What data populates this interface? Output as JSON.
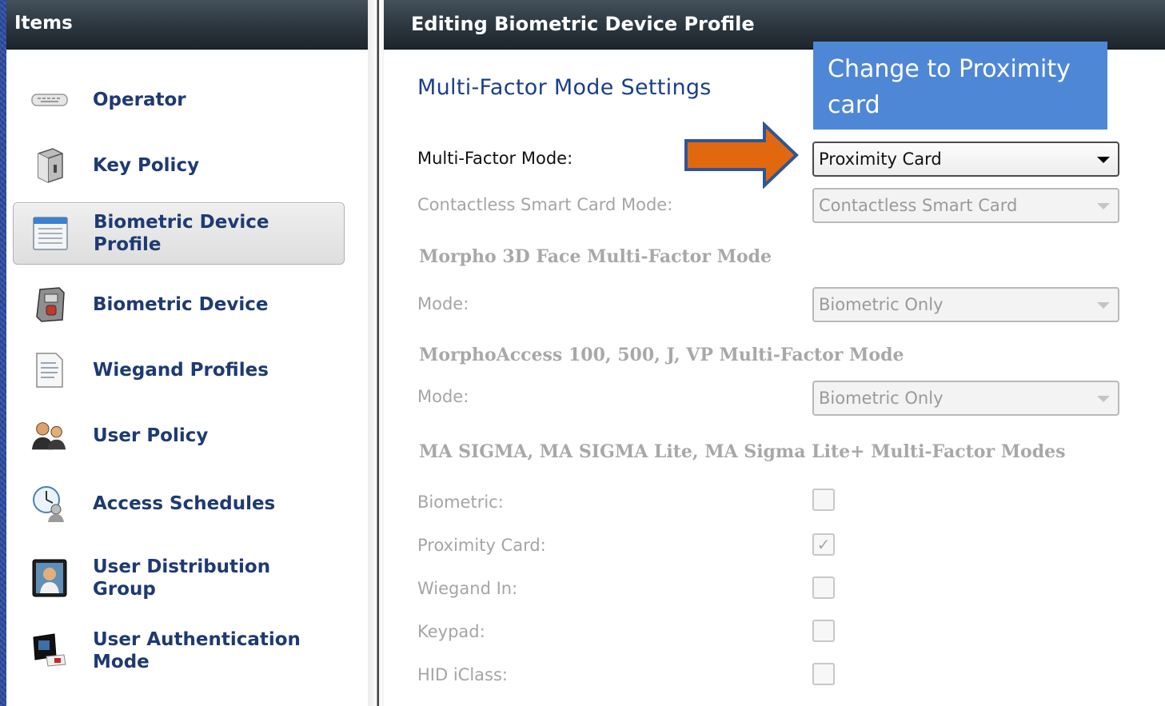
{
  "left_panel": {
    "title": "Items",
    "items": [
      {
        "label": "Operator",
        "icon": "keyboard-icon"
      },
      {
        "label": "Key Policy",
        "icon": "key-vault-icon"
      },
      {
        "label": "Biometric Device Profile",
        "icon": "profile-window-icon",
        "selected": true
      },
      {
        "label": "Biometric Device",
        "icon": "fingerprint-device-icon"
      },
      {
        "label": "Wiegand Profiles",
        "icon": "binary-document-icon"
      },
      {
        "label": "User Policy",
        "icon": "users-icon"
      },
      {
        "label": "Access Schedules",
        "icon": "clock-user-icon"
      },
      {
        "label": "User Distribution Group",
        "icon": "user-photo-group-icon"
      },
      {
        "label": "User Authentication Mode",
        "icon": "card-reader-hand-icon"
      }
    ]
  },
  "right_panel": {
    "title": "Editing Biometric Device Profile",
    "section_title": "Multi-Factor Mode Settings",
    "multi_factor_mode": {
      "label": "Multi-Factor Mode:",
      "value": "Proximity Card"
    },
    "contactless_mode": {
      "label": "Contactless Smart Card Mode:",
      "value": "Contactless Smart Card"
    },
    "morpho3d": {
      "title": "Morpho 3D Face Multi-Factor Mode",
      "mode_label": "Mode:",
      "mode_value": "Biometric Only"
    },
    "morphoaccess": {
      "title": "MorphoAccess 100, 500, J, VP Multi-Factor Mode",
      "mode_label": "Mode:",
      "mode_value": "Biometric Only"
    },
    "sigma": {
      "title": "MA SIGMA,  MA SIGMA Lite, MA Sigma Lite+ Multi-Factor Modes",
      "options": [
        {
          "label": "Biometric:",
          "checked": false
        },
        {
          "label": "Proximity Card:",
          "checked": true
        },
        {
          "label": "Wiegand In:",
          "checked": false
        },
        {
          "label": "Keypad:",
          "checked": false
        },
        {
          "label": "HID iClass:",
          "checked": false
        }
      ]
    }
  },
  "annotation": {
    "callout_text": "Change to Proximity card",
    "callout_color": "#4f87d7",
    "arrow_color": "#e2680f"
  },
  "check_mark": "✓"
}
